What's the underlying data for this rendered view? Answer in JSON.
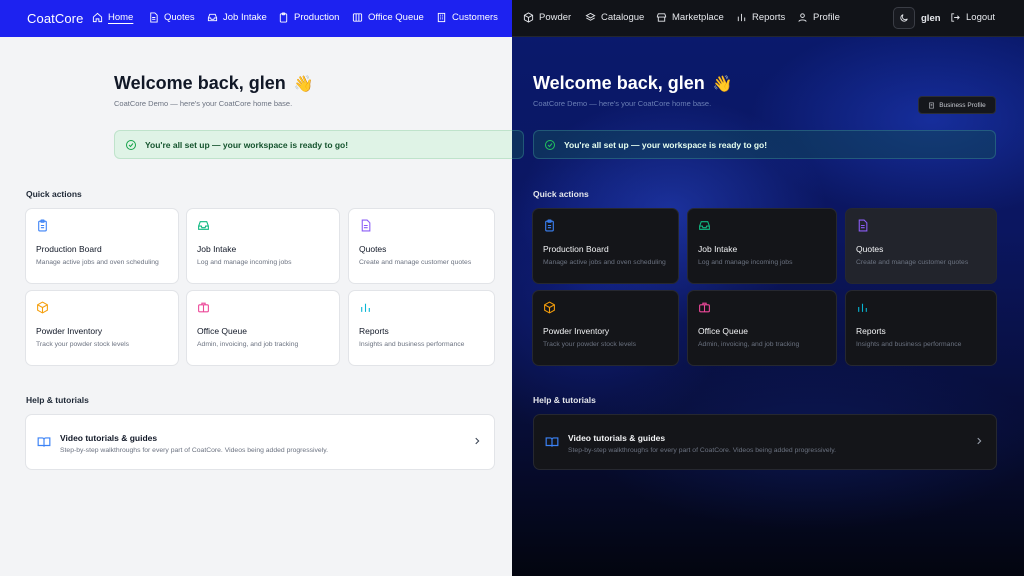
{
  "brand": "CoatCore",
  "nav": [
    {
      "label": "Home",
      "icon": "home-icon"
    },
    {
      "label": "Quotes",
      "icon": "file-icon"
    },
    {
      "label": "Job Intake",
      "icon": "inbox-icon"
    },
    {
      "label": "Production",
      "icon": "clipboard-icon"
    },
    {
      "label": "Office Queue",
      "icon": "columns-icon"
    },
    {
      "label": "Customers",
      "icon": "building-icon"
    },
    {
      "label": "Powder",
      "icon": "box-icon"
    },
    {
      "label": "Catalogue",
      "icon": "layers-icon"
    },
    {
      "label": "Marketplace",
      "icon": "store-icon"
    },
    {
      "label": "Reports",
      "icon": "chart-icon"
    },
    {
      "label": "Profile",
      "icon": "user-icon"
    }
  ],
  "user": {
    "name": "glen",
    "logout_label": "Logout"
  },
  "welcome": {
    "title": "Welcome back, glen",
    "emoji": "👋",
    "subtitle": "CoatCore Demo — here's your CoatCore home base."
  },
  "business_profile_label": "Business Profile",
  "banner": "You're all set up — your workspace is ready to go!",
  "quick_actions": {
    "title": "Quick actions",
    "cards": [
      {
        "title": "Production Board",
        "desc": "Manage active jobs and oven scheduling",
        "icon": "clipboard-icon",
        "color": "#3b82f6"
      },
      {
        "title": "Job Intake",
        "desc": "Log and manage incoming jobs",
        "icon": "inbox-icon",
        "color": "#10b981"
      },
      {
        "title": "Quotes",
        "desc": "Create and manage customer quotes",
        "icon": "file-icon",
        "color": "#8b5cf6"
      },
      {
        "title": "Powder Inventory",
        "desc": "Track your powder stock levels",
        "icon": "box-icon",
        "color": "#f59e0b"
      },
      {
        "title": "Office Queue",
        "desc": "Admin, invoicing, and job tracking",
        "icon": "briefcase-icon",
        "color": "#ec4899"
      },
      {
        "title": "Reports",
        "desc": "Insights and business performance",
        "icon": "chart-icon",
        "color": "#06b6d4"
      }
    ]
  },
  "help": {
    "title": "Help & tutorials",
    "card_title": "Video tutorials & guides",
    "card_desc": "Step-by-step walkthroughs for every part of CoatCore. Videos being added progressively."
  }
}
